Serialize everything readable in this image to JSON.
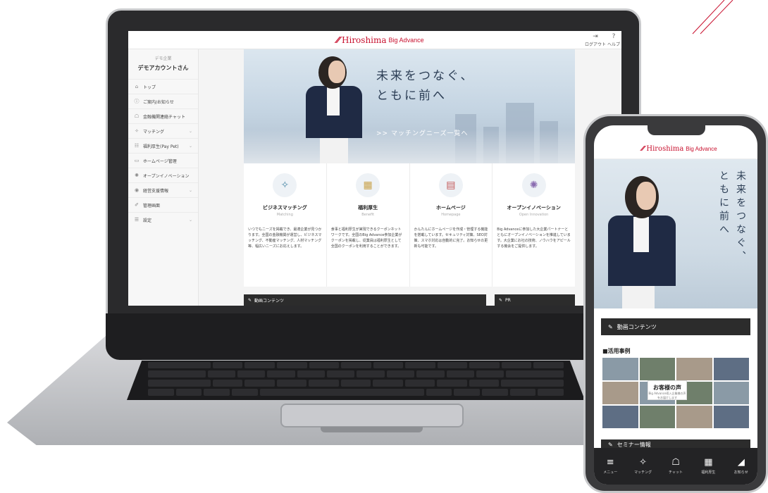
{
  "brand": {
    "name": "Hiroshima",
    "sub": "Big Advance",
    "color": "#c8102e"
  },
  "laptop": {
    "header": {
      "logout": "ログアウト",
      "help": "ヘルプ"
    },
    "sidebar": {
      "account_label": "デモ企業",
      "account_name": "デモアカウントさん",
      "items": [
        {
          "label": "トップ",
          "icon": "home-icon"
        },
        {
          "label": "ご案内/お知らせ",
          "icon": "info-icon"
        },
        {
          "label": "金融機関連絡チャット",
          "icon": "chat-icon"
        },
        {
          "label": "マッチング",
          "icon": "handshake-icon"
        },
        {
          "label": "福利厚生(Pay Pet)",
          "icon": "benefits-icon"
        },
        {
          "label": "ホームページ管理",
          "icon": "homepage-icon"
        },
        {
          "label": "オープンイノベーション",
          "icon": "bulb-icon"
        },
        {
          "label": "経営支援情報",
          "icon": "support-icon"
        },
        {
          "label": "管理画面",
          "icon": "admin-icon"
        },
        {
          "label": "設定",
          "icon": "settings-icon"
        }
      ]
    },
    "hero": {
      "title_line1": "未来をつなぐ、",
      "title_line2": "ともに前へ",
      "link": ">> マッチングニーズ一覧へ"
    },
    "cards": [
      {
        "title": "ビジネスマッチング",
        "sub": "Matching",
        "icon": "handshake-icon",
        "desc": "いつでもニーズを掲載でき、最適企業が見つかります。全国の金融機関が運営し、ビジネスマッチング、不動産マッチング、人材マッチング等、幅広いニーズにお応えします。"
      },
      {
        "title": "福利厚生",
        "sub": "Benefit",
        "icon": "gift-icon",
        "desc": "食事と福利厚生が実現できるクーポンネットワークです。全国のBig Advance参加企業がクーポンを掲載し、従業員は福利厚生として全国のクーポンを利用することができます。"
      },
      {
        "title": "ホームページ",
        "sub": "Homepage",
        "icon": "browser-icon",
        "desc": "かんたんにホームページを作成・管理する機能を搭載しています。セキュリティ対策、SEO対策、スマホ対応は自動的に完了。お知らせの更新も可能です。"
      },
      {
        "title": "オープンイノベーション",
        "sub": "Open Innovation",
        "icon": "bulb-icon",
        "desc": "Big Advanceに参加した大企業パートナーとともにオープンイノベーションを推進しています。大企業にお社の技術、ノウハウをアピールする機会をご提供します。"
      }
    ],
    "sections": [
      {
        "label": "動画コンテンツ"
      },
      {
        "label": "PR"
      }
    ]
  },
  "phone": {
    "hero": {
      "col1": "未来をつなぐ、",
      "col2": "ともに前へ"
    },
    "section_video": "動画コンテンツ",
    "cases_label": "■活用事例",
    "voice_title": "お客様の声",
    "voice_sub": "Big Advance導入企業様の声をお届けします",
    "section_seminar": "セミナー情報",
    "tabs": [
      {
        "label": "メニュー",
        "icon": "menu-icon"
      },
      {
        "label": "マッチング",
        "icon": "handshake-icon"
      },
      {
        "label": "チャット",
        "icon": "chat-icon"
      },
      {
        "label": "福利厚生",
        "icon": "gift-icon"
      },
      {
        "label": "お知らせ",
        "icon": "megaphone-icon"
      }
    ]
  }
}
